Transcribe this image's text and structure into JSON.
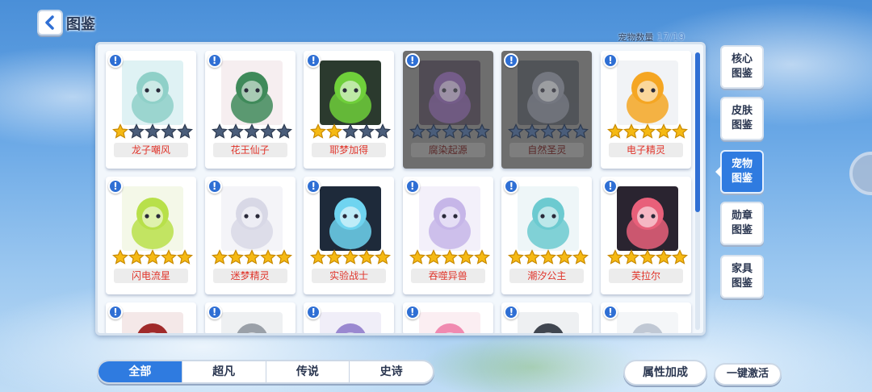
{
  "header": {
    "title": "图鉴",
    "back_icon": "chevron-left-icon"
  },
  "pet_count": {
    "label": "宠物数量",
    "value": "17/19"
  },
  "pets": [
    {
      "name": "龙子嘲风",
      "stars": 1,
      "locked": false,
      "icon": "white-dragon-portrait",
      "bg": "#dff2f4",
      "tone": "#8fd0c8"
    },
    {
      "name": "花王仙子",
      "stars": 0,
      "locked": false,
      "icon": "flower-fairy-portrait",
      "bg": "#f6eef0",
      "tone": "#3f8a5a"
    },
    {
      "name": "耶梦加得",
      "stars": 2,
      "locked": false,
      "icon": "serpent-portrait",
      "bg": "#2b3a2e",
      "tone": "#6fcf3a"
    },
    {
      "name": "腐染起源",
      "stars": 0,
      "locked": true,
      "icon": "dark-dragon-portrait",
      "bg": "#3a3040",
      "tone": "#7a4fa0"
    },
    {
      "name": "自然圣灵",
      "stars": 0,
      "locked": true,
      "icon": "wolf-spirit-portrait",
      "bg": "#3b4048",
      "tone": "#7a8090"
    },
    {
      "name": "电子精灵",
      "stars": 5,
      "locked": false,
      "icon": "robot-spirit-portrait",
      "bg": "#f1f3f6",
      "tone": "#f5a623"
    },
    {
      "name": "闪电流星",
      "stars": 5,
      "locked": false,
      "icon": "lightning-cat-portrait",
      "bg": "#f4f8e8",
      "tone": "#b8e04a"
    },
    {
      "name": "迷梦精灵",
      "stars": 5,
      "locked": false,
      "icon": "dream-spirit-portrait",
      "bg": "#f4f4f8",
      "tone": "#d8d8e6"
    },
    {
      "name": "实验战士",
      "stars": 5,
      "locked": false,
      "icon": "experiment-warrior-portrait",
      "bg": "#1e2a3a",
      "tone": "#6fd4f0"
    },
    {
      "name": "吞噬异兽",
      "stars": 5,
      "locked": false,
      "icon": "devour-beast-portrait",
      "bg": "#f3f0fa",
      "tone": "#c6b6e8"
    },
    {
      "name": "潮汐公主",
      "stars": 5,
      "locked": false,
      "icon": "tide-princess-portrait",
      "bg": "#eef6f8",
      "tone": "#6ccad0"
    },
    {
      "name": "芙拉尔",
      "stars": 5,
      "locked": false,
      "icon": "flair-portrait",
      "bg": "#2a2430",
      "tone": "#e8607a"
    },
    {
      "name": "",
      "stars": 0,
      "locked": false,
      "icon": "red-dragon-portrait",
      "bg": "#f4e8e8",
      "tone": "#a02a2a"
    },
    {
      "name": "",
      "stars": 0,
      "locked": false,
      "icon": "grey-beast-portrait",
      "bg": "#eef0f2",
      "tone": "#9aa0a8"
    },
    {
      "name": "",
      "stars": 0,
      "locked": false,
      "icon": "purple-ghost-portrait",
      "bg": "#f0eef8",
      "tone": "#9a88d0"
    },
    {
      "name": "",
      "stars": 0,
      "locked": false,
      "icon": "pink-creature-portrait",
      "bg": "#fbeef2",
      "tone": "#f08ab0"
    },
    {
      "name": "",
      "stars": 0,
      "locked": false,
      "icon": "shadow-wolf-portrait",
      "bg": "#eef0f2",
      "tone": "#404650"
    },
    {
      "name": "",
      "stars": 0,
      "locked": false,
      "icon": "snow-creature-portrait",
      "bg": "#f4f6f8",
      "tone": "#c0c8d4"
    }
  ],
  "side_tabs": [
    {
      "label_1": "核心",
      "label_2": "图鉴",
      "active": false
    },
    {
      "label_1": "皮肤",
      "label_2": "图鉴",
      "active": false
    },
    {
      "label_1": "宠物",
      "label_2": "图鉴",
      "active": true
    },
    {
      "label_1": "勋章",
      "label_2": "图鉴",
      "active": false
    },
    {
      "label_1": "家具",
      "label_2": "图鉴",
      "active": false
    }
  ],
  "filters": [
    "全部",
    "超凡",
    "传说",
    "史诗"
  ],
  "filter_selected": "全部",
  "buttons": {
    "attribute_bonus": "属性加成",
    "one_click_activate": "一键激活"
  },
  "colors": {
    "accent": "#2f7be0",
    "star_filled": "#f5b914",
    "star_empty": "#4a5d7a",
    "name_text": "#e0352b"
  }
}
